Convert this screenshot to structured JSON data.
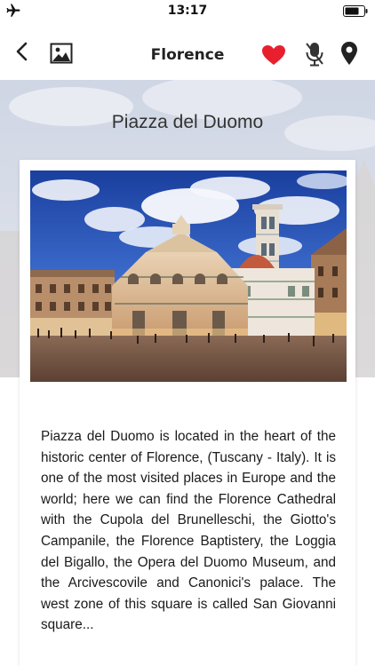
{
  "status_bar": {
    "time": "13:17",
    "airplane_icon": "airplane-icon",
    "battery_icon": "battery-icon"
  },
  "nav": {
    "title": "Florence",
    "icons": [
      "back-chevron-icon",
      "gallery-icon",
      "heart-icon",
      "microphone-icon",
      "map-pin-icon"
    ],
    "heart_color": "#e8202e"
  },
  "place": {
    "heading": "Piazza del Duomo",
    "description": "Piazza del Duomo is located in the heart of the historic center of Florence, (Tuscany - Italy). It is one of the most visited places in Europe and the world; here we can find the Florence Cathedral with the Cupola del Brunelleschi, the Giotto's Campanile, the Florence Baptistery, the Loggia del Bigallo, the Opera del Duomo Museum, and the Arcivescovile and Canonici's palace. The west zone of this square is called San Giovanni square..."
  }
}
